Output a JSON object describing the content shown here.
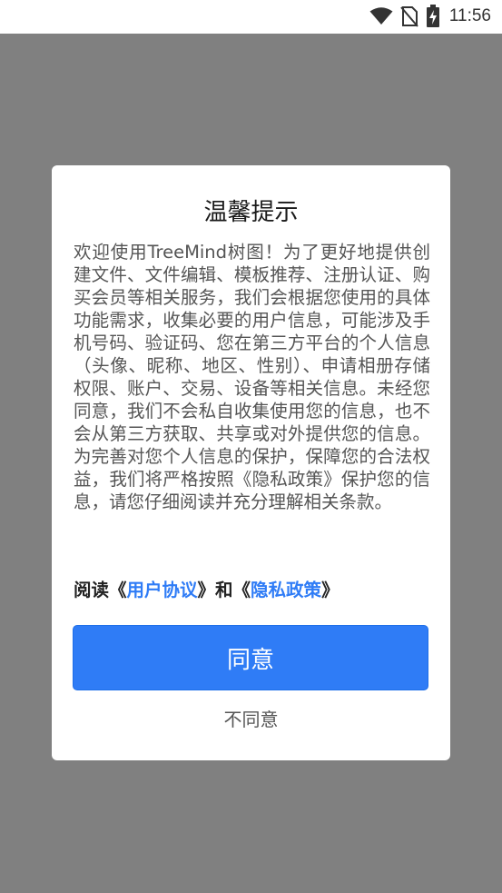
{
  "status_bar": {
    "time": "11:56",
    "icons": [
      "wifi-icon",
      "no-sim-icon",
      "battery-charging-icon"
    ]
  },
  "dialog": {
    "title": "温馨提示",
    "body": "欢迎使用TreeMind树图！为了更好地提供创建文件、文件编辑、模板推荐、注册认证、购买会员等相关服务，我们会根据您使用的具体功能需求，收集必要的用户信息，可能涉及手机号码、验证码、您在第三方平台的个人信息（头像、昵称、地区、性别）、申请相册存储权限、账户、交易、设备等相关信息。未经您同意，我们不会私自收集使用您的信息，也不会从第三方获取、共享或对外提供您的信息。为完善对您个人信息的保护，保障您的合法权益，我们将严格按照《隐私政策》保护您的信息，请您仔细阅读并充分理解相关条款。",
    "links": {
      "prefix": "阅读《",
      "user_agreement": "用户协议",
      "middle": "》和《",
      "privacy_policy": "隐私政策",
      "suffix": "》"
    },
    "agree_label": "同意",
    "disagree_label": "不同意"
  },
  "colors": {
    "accent": "#2f7cf6",
    "overlay": "#808080"
  }
}
